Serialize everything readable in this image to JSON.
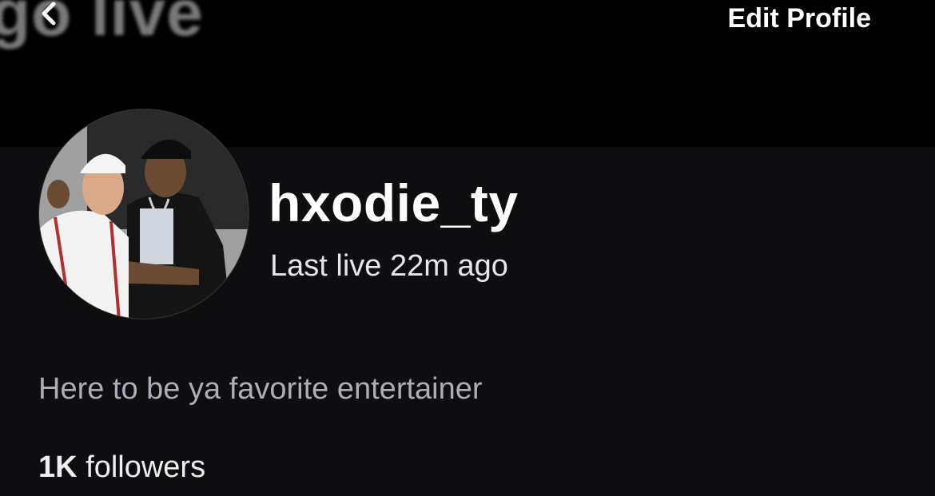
{
  "banner": {
    "text": "go live"
  },
  "header": {
    "edit_profile_label": "Edit Profile"
  },
  "profile": {
    "username": "hxodie_ty",
    "last_live": "Last live 22m ago",
    "bio": "Here to be ya favorite entertainer",
    "followers_count": "1K",
    "followers_label": "followers",
    "avatar": "avatar-photo-two-men"
  },
  "colors": {
    "page_background": "#0e0e10",
    "banner_background": "#000000",
    "primary_text": "#ffffff",
    "secondary_text": "#adadb8"
  },
  "icons": {
    "back": "chevron-left-icon"
  }
}
